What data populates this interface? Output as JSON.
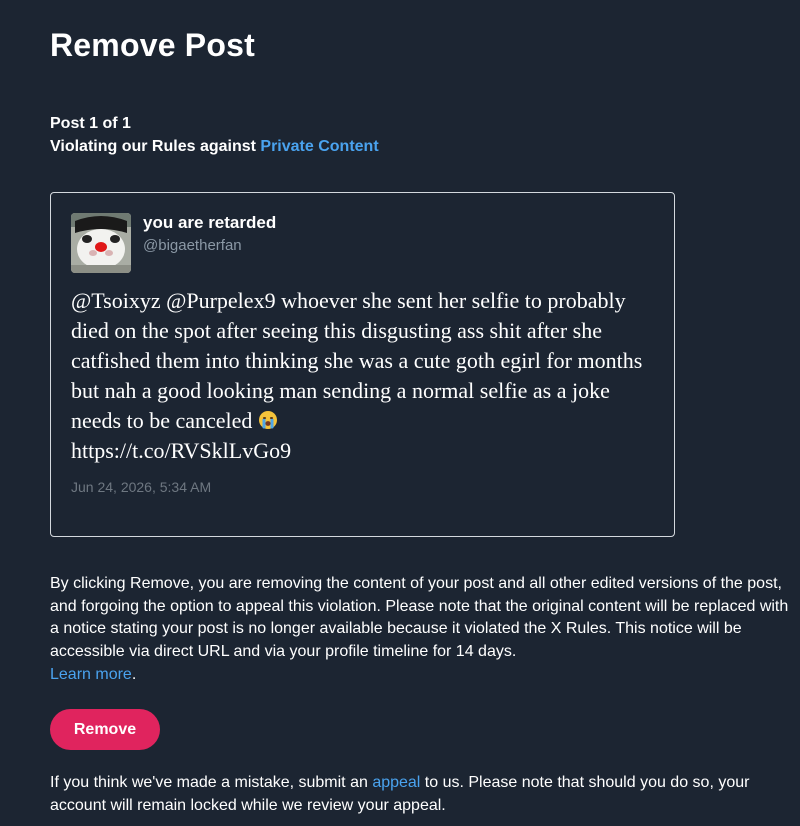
{
  "page": {
    "title": "Remove Post",
    "post_counter": "Post 1 of 1",
    "violation_prefix": "Violating our Rules against ",
    "violation_link": "Private Content"
  },
  "post": {
    "author_name": "you are retarded",
    "author_handle": "@bigaetherfan",
    "text": "@Tsoixyz @Purpelex9 whoever she sent her selfie to probably died on the spot after seeing this disgusting ass shit after she catfished them into thinking she was a cute goth egirl for months but nah a good looking man sending a normal selfie as a joke needs to be canceled",
    "emoji": "loudly-crying-face-icon",
    "link": "https://t.co/RVSklLvGo9",
    "date": "Jun 24, 2026, 5:34 AM"
  },
  "notice": {
    "text": "By clicking Remove, you are removing the content of your post and all other edited versions of the post, and forgoing the option to appeal this violation. Please note that the original content will be replaced with a notice stating your post is no longer available because it violated the X Rules. This notice will be accessible via direct URL and via your profile timeline for 14 days.",
    "learn_more": "Learn more",
    "end": "."
  },
  "remove_button": "Remove",
  "footer": {
    "prefix": "If you think we've made a mistake, submit an ",
    "appeal_link": "appeal",
    "suffix": " to us. Please note that should you do so, your account will remain locked while we review your appeal."
  },
  "colors": {
    "background": "#1c2532",
    "link": "#4aa3ef",
    "remove_button": "#e0245e",
    "card_border": "#d4d9de",
    "handle": "#8b98a5"
  }
}
